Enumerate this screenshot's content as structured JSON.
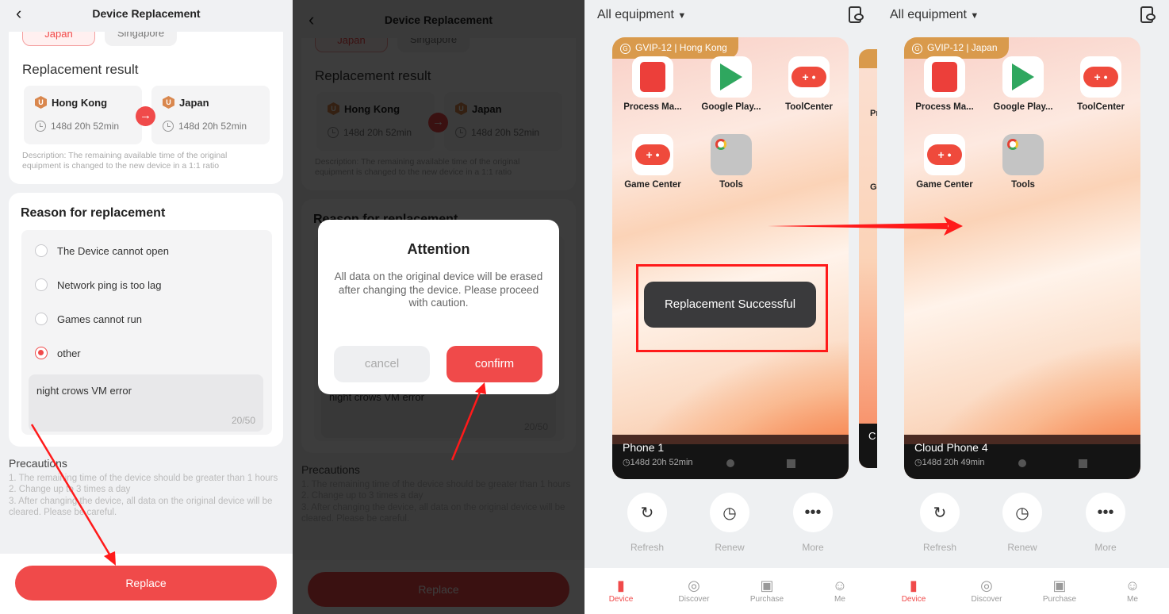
{
  "replace_page": {
    "title": "Device Replacement",
    "region_tabs": [
      "Japan",
      "Singapore"
    ],
    "result_heading": "Replacement result",
    "from": {
      "region": "Hong Kong",
      "time": "148d 20h 52min"
    },
    "to": {
      "region": "Japan",
      "time": "148d 20h 52min"
    },
    "description": "Description: The remaining available time of the original equipment is changed to the new device in a 1:1 ratio",
    "reason_heading": "Reason for replacement",
    "reasons": [
      "The Device cannot open",
      "Network ping is too lag",
      "Games cannot run",
      "other"
    ],
    "selected_reason": "other",
    "reason_text": "night crows VM error",
    "char_count": "20/50",
    "precautions_heading": "Precautions",
    "precautions": [
      "1. The remaining time of the device should be greater than 1 hours",
      "2. Change up to 3 times a day",
      "3. After changing the device, all data on the original device will be cleared. Please be careful."
    ],
    "replace_button": "Replace"
  },
  "dialog": {
    "title": "Attention",
    "message": "All data on the original device will be erased after changing the device. Please proceed with caution.",
    "cancel": "cancel",
    "confirm": "confirm"
  },
  "devices": [
    {
      "filter": "All equipment",
      "tag": "GVIP-12 | Hong Kong",
      "name": "Phone 1",
      "time": "148d 20h 52min",
      "toast": "Replacement Successful"
    },
    {
      "filter": "All equipment",
      "tag": "GVIP-12 | Japan",
      "name": "Cloud Phone 4",
      "time": "148d 20h 49min"
    }
  ],
  "side_card": {
    "label1": "Pr",
    "label2": "G",
    "name": "C"
  },
  "apps": [
    "Process Ma...",
    "Google Play...",
    "ToolCenter",
    "Game Center",
    "Tools"
  ],
  "actions": [
    "Refresh",
    "Renew",
    "More"
  ],
  "nav": [
    "Device",
    "Discover",
    "Purchase",
    "Me"
  ],
  "colors": {
    "accent": "#f04a4a",
    "tag": "#d99a4c",
    "annotation": "#ff1a1a"
  }
}
